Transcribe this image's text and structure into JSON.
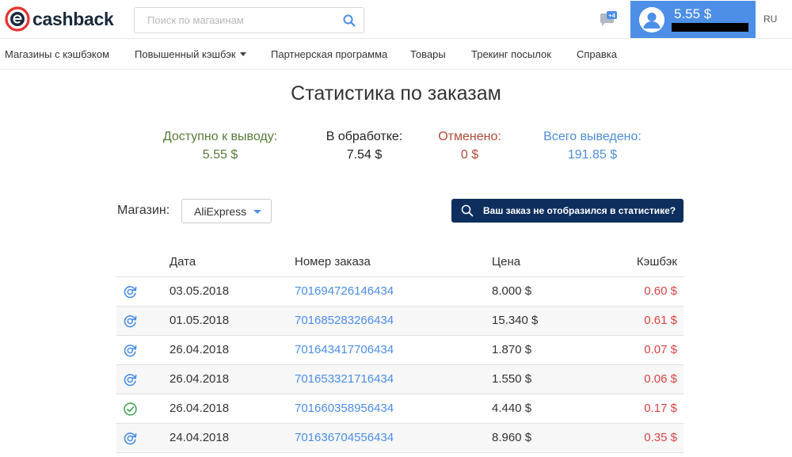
{
  "header": {
    "logo_text": "cashback",
    "search_placeholder": "Поиск по магазинам",
    "notifications_badge": "+4",
    "balance": "5.55 $",
    "lang": "RU"
  },
  "nav": {
    "items": [
      {
        "label": "Магазины с кэшбэком"
      },
      {
        "label": "Повышенный кэшбэк"
      },
      {
        "label": "Партнерская программа"
      },
      {
        "label": "Товары"
      },
      {
        "label": "Трекинг посылок"
      },
      {
        "label": "Справка"
      }
    ]
  },
  "page": {
    "title": "Статистика по заказам"
  },
  "stats": [
    {
      "label": "Доступно к выводу:",
      "value": "5.55 $",
      "color": "#5a7a3a"
    },
    {
      "label": "В обработке:",
      "value": "7.54 $",
      "color": "#222222"
    },
    {
      "label": "Отменено:",
      "value": "0 $",
      "color": "#b24a3a"
    },
    {
      "label": "Всего выведено:",
      "value": "191.85 $",
      "color": "#4d8ed6"
    }
  ],
  "filter": {
    "shop_label": "Магазин:",
    "shop_value": "AliExpress",
    "missing_button": "Ваш заказ не отобразился в статистике?"
  },
  "table": {
    "headers": {
      "date": "Дата",
      "order": "Номер заказа",
      "price": "Цена",
      "cashback": "Кэшбэк"
    },
    "rows": [
      {
        "status": "pending",
        "date": "03.05.2018",
        "order": "701694726146434",
        "price": "8.000 $",
        "cashback": "0.60 $"
      },
      {
        "status": "pending",
        "date": "01.05.2018",
        "order": "701685283266434",
        "price": "15.340 $",
        "cashback": "0.61 $"
      },
      {
        "status": "pending",
        "date": "26.04.2018",
        "order": "701643417706434",
        "price": "1.870 $",
        "cashback": "0.07 $"
      },
      {
        "status": "pending",
        "date": "26.04.2018",
        "order": "701653321716434",
        "price": "1.550 $",
        "cashback": "0.06 $"
      },
      {
        "status": "approved",
        "date": "26.04.2018",
        "order": "701660358956434",
        "price": "4.440 $",
        "cashback": "0.17 $"
      },
      {
        "status": "pending",
        "date": "24.04.2018",
        "order": "701636704556434",
        "price": "8.960 $",
        "cashback": "0.35 $"
      }
    ]
  },
  "colors": {
    "accent": "#4d8ee6",
    "dark_button": "#0e2f5e",
    "cashback_red": "#d84444",
    "approved_green": "#3aa04a",
    "brand_red": "#e8312f"
  }
}
